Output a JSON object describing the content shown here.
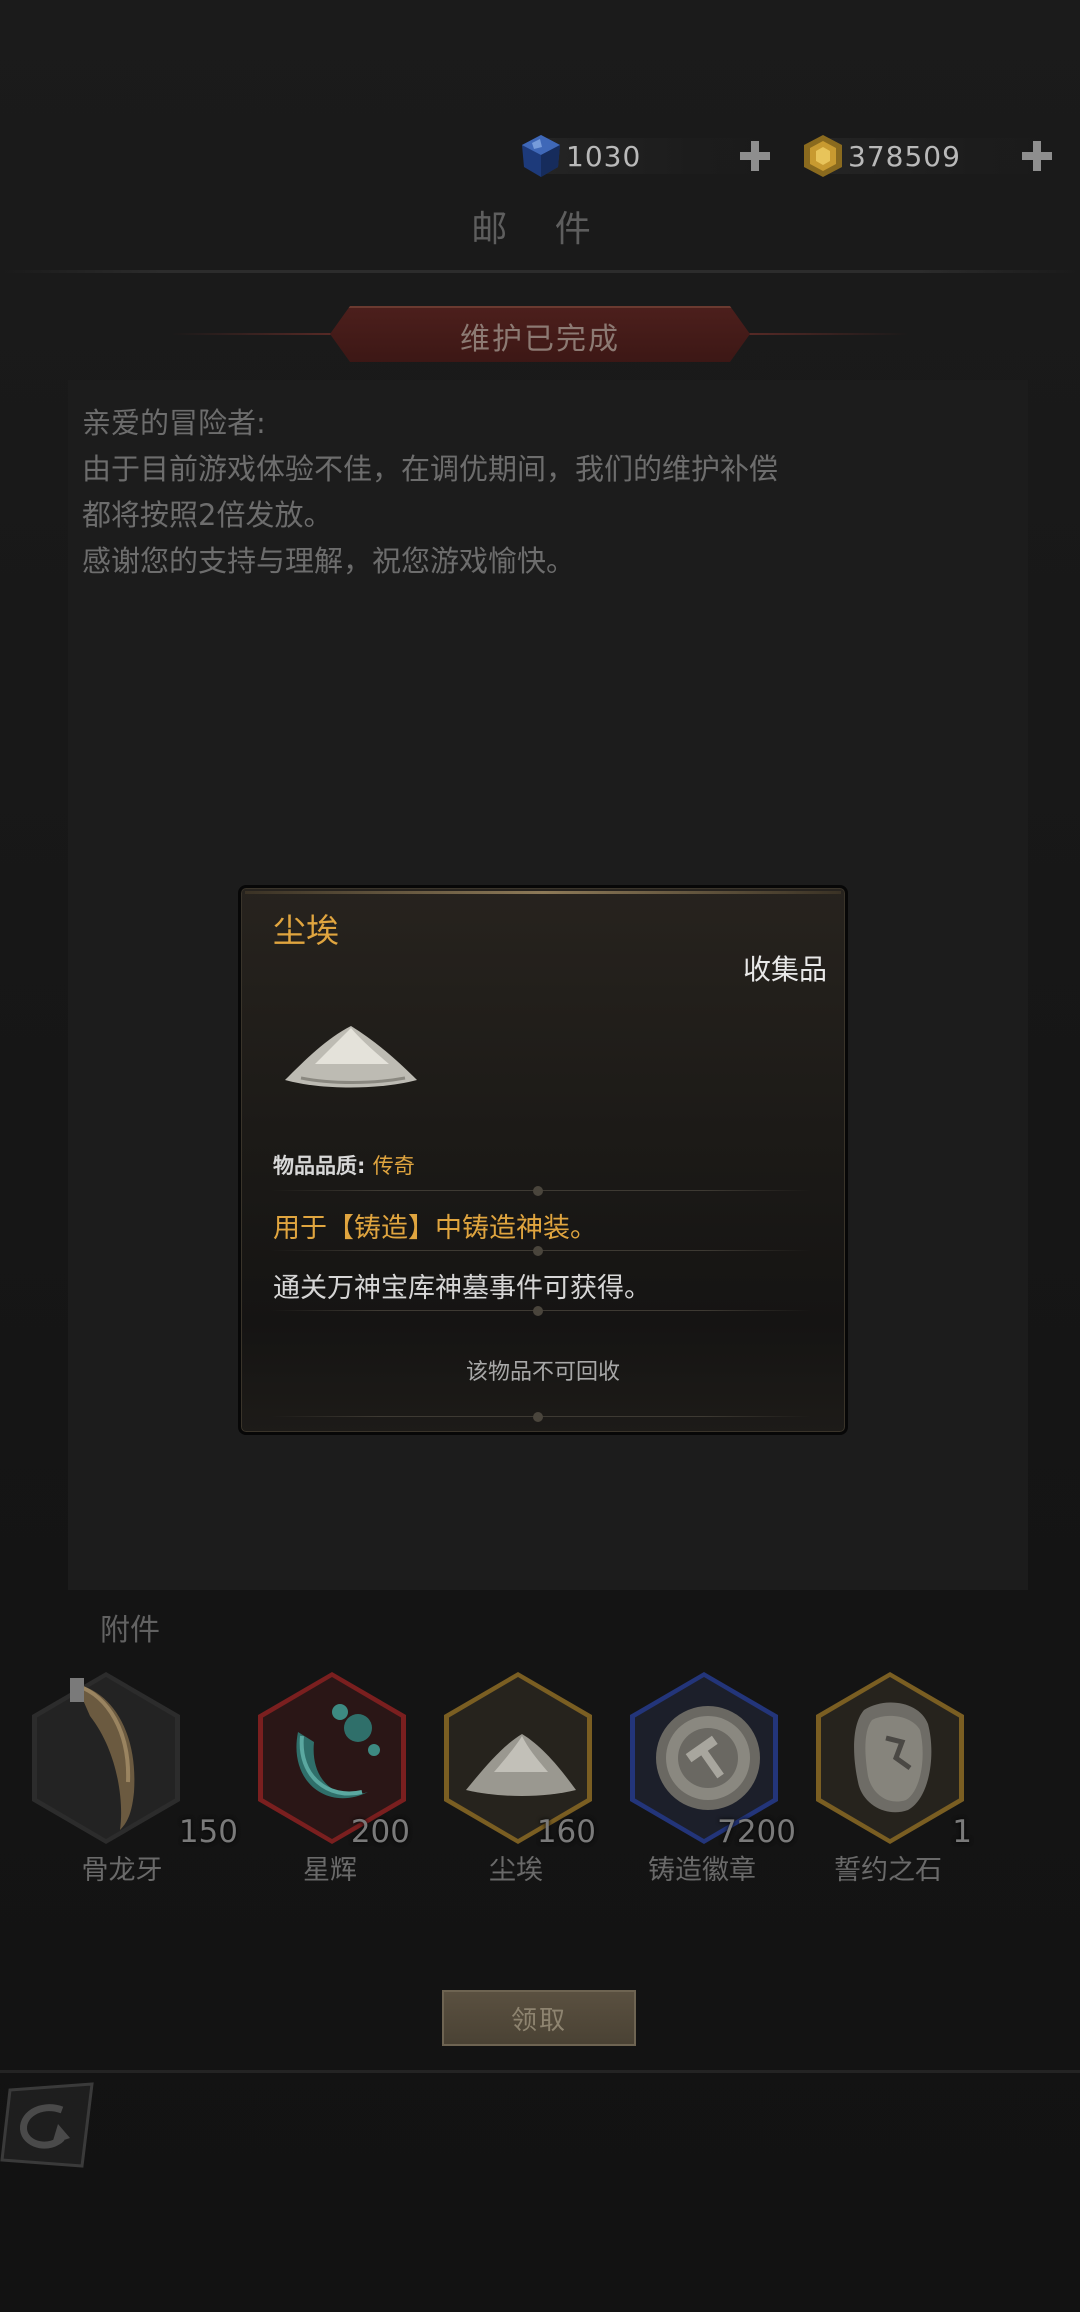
{
  "currencies": [
    {
      "icon": "blue-gem-icon",
      "value": "1030"
    },
    {
      "icon": "gold-coin-icon",
      "value": "378509"
    }
  ],
  "title": "邮  件",
  "banner": "维护已完成",
  "mail": {
    "lines": [
      "亲爱的冒险者:",
      "由于目前游戏体验不佳，在调优期间，我们的维护补偿",
      "都将按照2倍发放。",
      "感谢您的支持与理解，祝您游戏愉快。"
    ]
  },
  "attachments": {
    "title": "附件",
    "items": [
      {
        "name": "骨龙牙",
        "qty": "150",
        "icon": "bone-fang-icon",
        "rarity": "common",
        "border": "#303030"
      },
      {
        "name": "星辉",
        "qty": "200",
        "icon": "starlight-icon",
        "rarity": "red",
        "border": "#7a1f1f"
      },
      {
        "name": "尘埃",
        "qty": "160",
        "icon": "dust-icon",
        "rarity": "gold",
        "border": "#7a5e22"
      },
      {
        "name": "铸造徽章",
        "qty": "7200",
        "icon": "forge-badge-icon",
        "rarity": "blue",
        "border": "#23357a"
      },
      {
        "name": "誓约之石",
        "qty": "1",
        "icon": "oath-stone-icon",
        "rarity": "gold",
        "border": "#7a5e22"
      }
    ]
  },
  "claim_label": "领取",
  "tooltip": {
    "name": "尘埃",
    "type": "收集品",
    "quality_label": "物品品质:",
    "quality_value": "传奇",
    "usage": "用于【铸造】中铸造神装。",
    "source": "通关万神宝库神墓事件可获得。",
    "note": "该物品不可回收"
  },
  "colors": {
    "accent_gold": "#e0a53f",
    "banner_red": "#4c1f1c"
  }
}
